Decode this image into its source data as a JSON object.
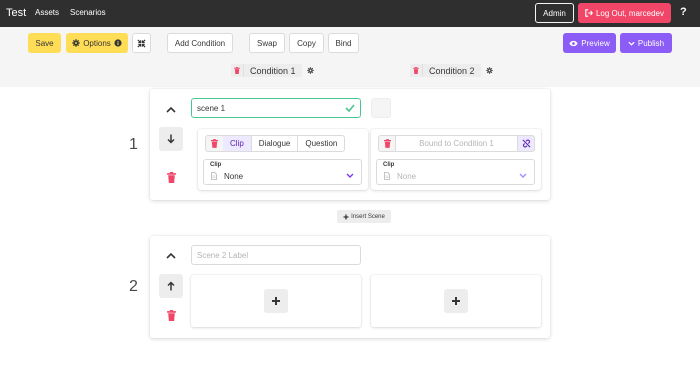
{
  "nav": {
    "brand": "Test",
    "links": [
      "Assets",
      "Scenarios"
    ],
    "admin_label": "Admin",
    "logout_label": "Log Out, marcedev",
    "help_label": "?"
  },
  "toolbar": {
    "save_label": "Save",
    "options_label": "Options",
    "add_condition_label": "Add Condition",
    "swap_label": "Swap",
    "copy_label": "Copy",
    "bind_label": "Bind",
    "preview_label": "Preview",
    "publish_label": "Publish"
  },
  "conditions": [
    {
      "label": "Condition 1"
    },
    {
      "label": "Condition 2"
    }
  ],
  "scenes": [
    {
      "number": "1",
      "label_value": "scene 1",
      "condition1": {
        "tabs": [
          "Clip",
          "Dialogue",
          "Question"
        ],
        "active_tab": "Clip",
        "clip_label": "Clip",
        "clip_value": "None"
      },
      "condition2": {
        "bound_text": "Bound to Condition 1",
        "clip_label": "Clip",
        "clip_value": "None"
      }
    },
    {
      "number": "2",
      "label_placeholder": "Scene 2 Label"
    }
  ],
  "insert_scene_label": "Insert Scene",
  "colors": {
    "nav_bg": "#2f2f2f",
    "yellow": "#ffdd57",
    "danger": "#f14668",
    "purple": "#8b5cf6",
    "success": "#48c78e"
  }
}
